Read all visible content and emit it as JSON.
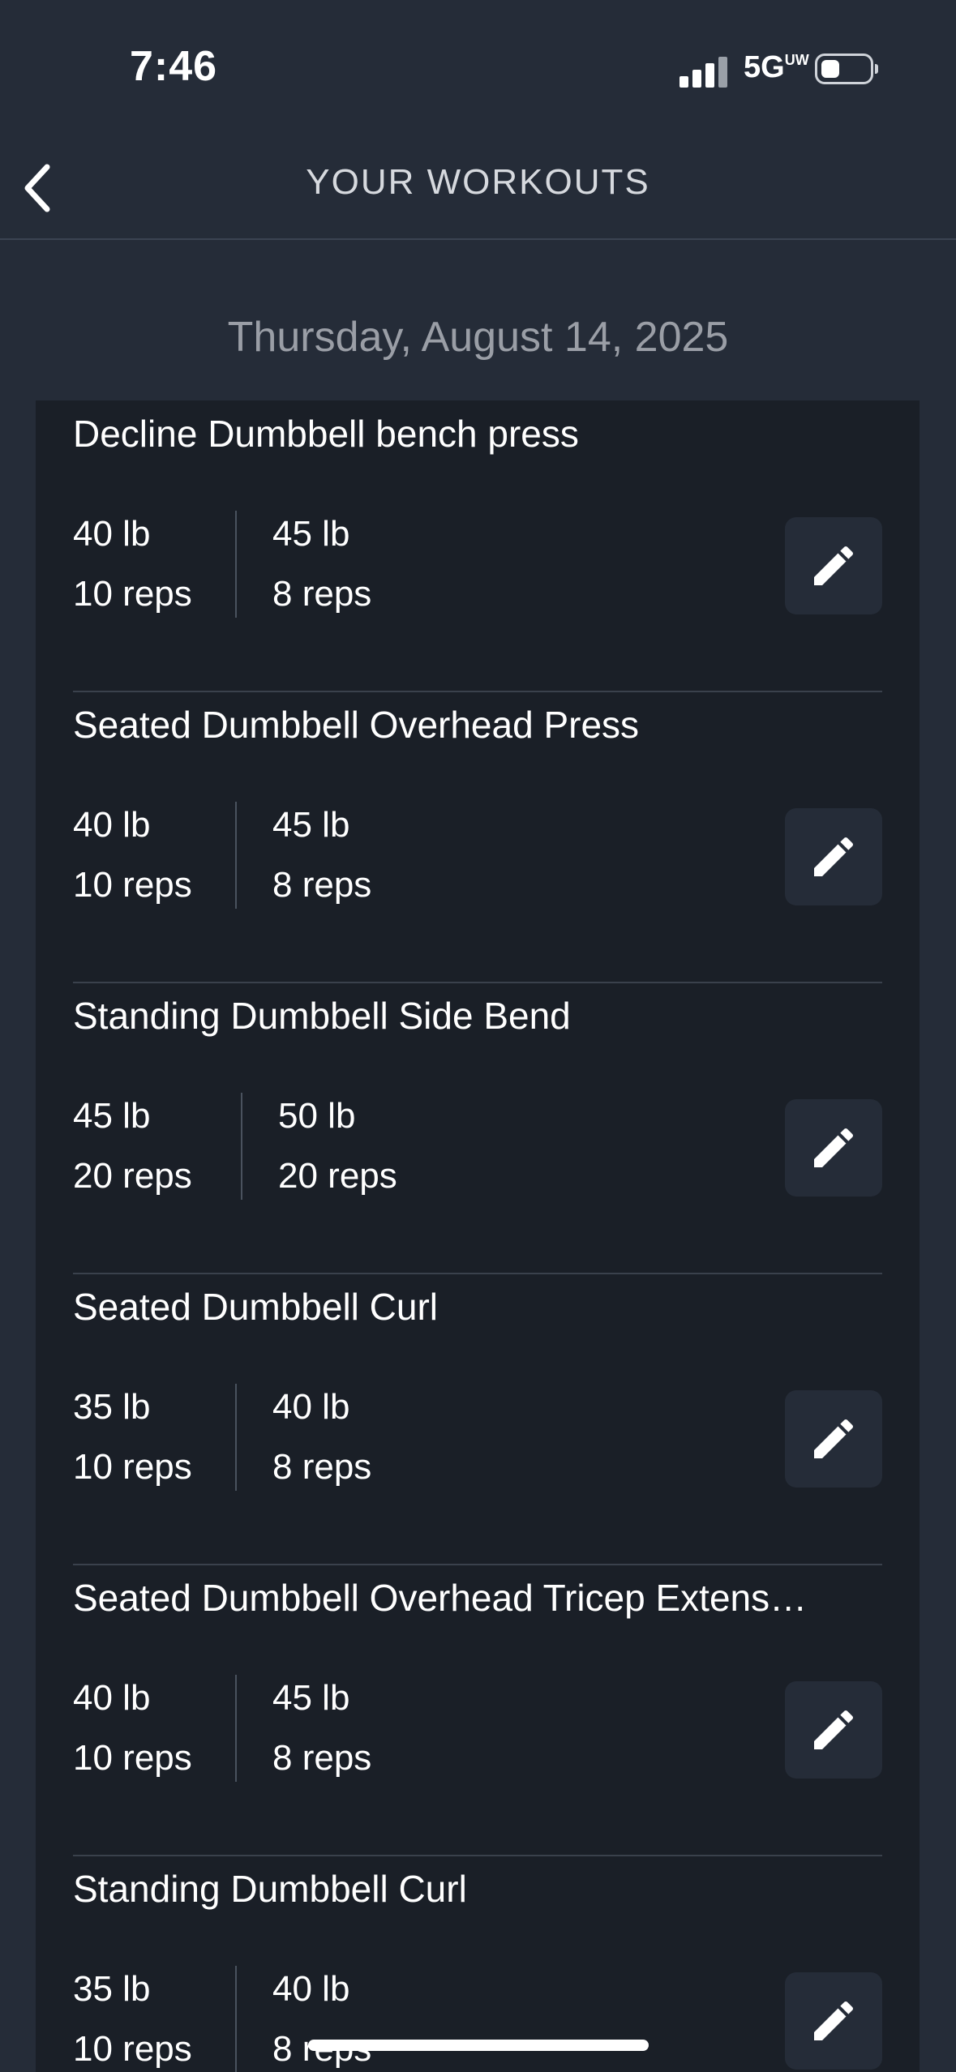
{
  "status_bar": {
    "time": "7:46",
    "network": "5G",
    "network_badge": "UW"
  },
  "nav": {
    "title": "YOUR WORKOUTS"
  },
  "date": "Thursday, August 14, 2025",
  "workouts": [
    {
      "name": "Decline Dumbbell bench press",
      "sets": [
        {
          "weight": "40 lb",
          "reps": "10 reps"
        },
        {
          "weight": "45 lb",
          "reps": "8 reps"
        }
      ]
    },
    {
      "name": "Seated Dumbbell Overhead Press",
      "sets": [
        {
          "weight": "40 lb",
          "reps": "10 reps"
        },
        {
          "weight": "45 lb",
          "reps": "8 reps"
        }
      ]
    },
    {
      "name": "Standing Dumbbell Side Bend",
      "sets": [
        {
          "weight": "45 lb",
          "reps": "20 reps"
        },
        {
          "weight": "50 lb",
          "reps": "20 reps"
        }
      ]
    },
    {
      "name": "Seated Dumbbell Curl",
      "sets": [
        {
          "weight": "35 lb",
          "reps": "10 reps"
        },
        {
          "weight": "40 lb",
          "reps": "8 reps"
        }
      ]
    },
    {
      "name": "Seated Dumbbell Overhead Tricep Extens…",
      "sets": [
        {
          "weight": "40 lb",
          "reps": "10 reps"
        },
        {
          "weight": "45 lb",
          "reps": "8 reps"
        }
      ]
    },
    {
      "name": "Standing Dumbbell Curl",
      "sets": [
        {
          "weight": "35 lb",
          "reps": "10 reps"
        },
        {
          "weight": "40 lb",
          "reps": "8 reps"
        }
      ]
    }
  ],
  "icons": {
    "back": "chevron-left-icon",
    "edit": "pencil-icon"
  },
  "colors": {
    "background": "#252c38",
    "card": "#1a1f27",
    "text": "#ffffff",
    "muted": "#9a9ea6"
  }
}
